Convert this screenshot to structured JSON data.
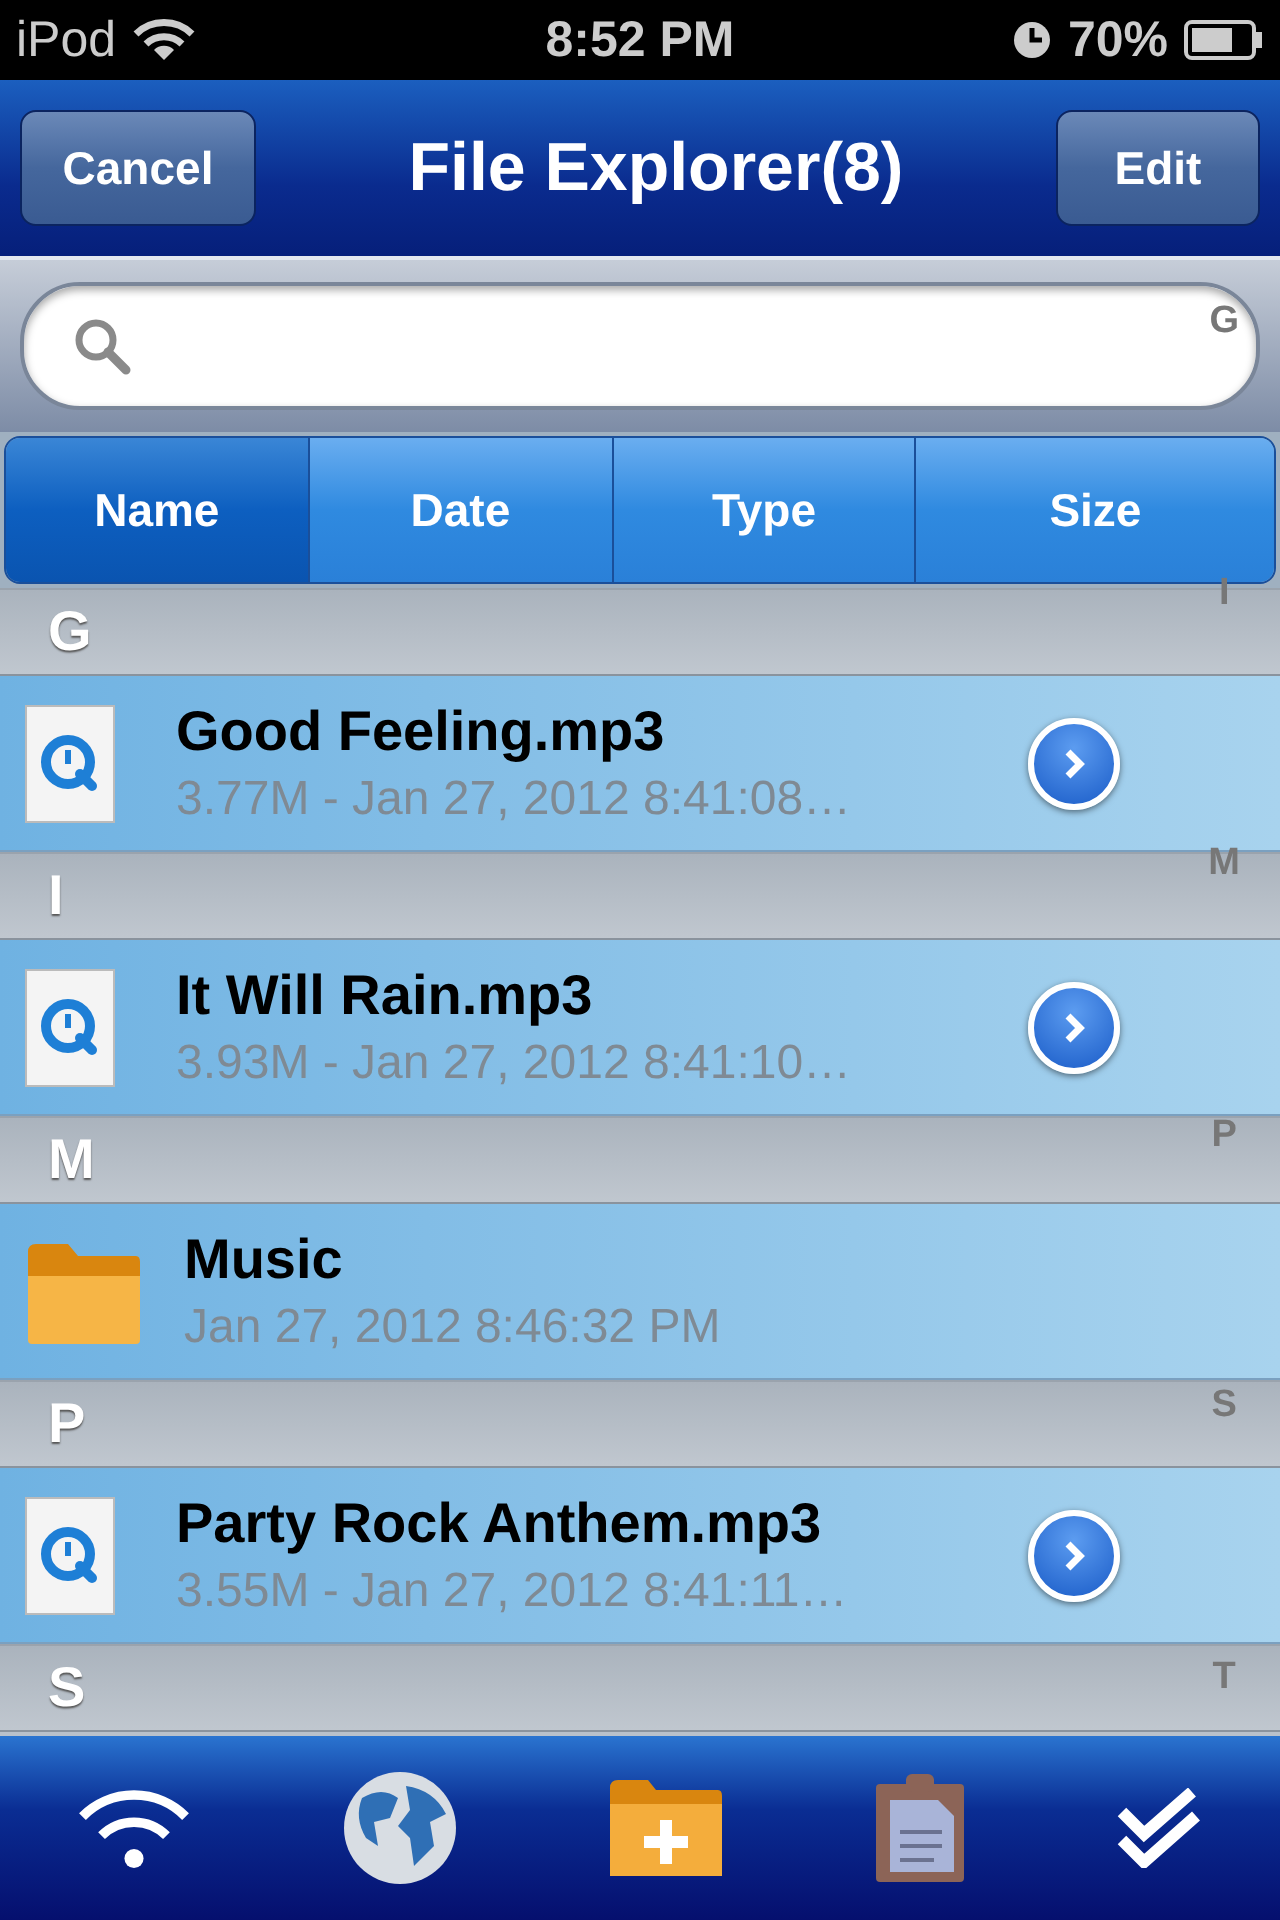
{
  "status_bar": {
    "device": "iPod",
    "time": "8:52 PM",
    "battery": "70%"
  },
  "nav": {
    "left_button": "Cancel",
    "title": "File Explorer(8)",
    "right_button": "Edit"
  },
  "sort_tabs": [
    {
      "label": "Name",
      "selected": true
    },
    {
      "label": "Date",
      "selected": false
    },
    {
      "label": "Type",
      "selected": false
    },
    {
      "label": "Size",
      "selected": false
    }
  ],
  "sections": [
    {
      "letter": "G",
      "items": [
        {
          "kind": "audio",
          "name": "Good Feeling.mp3",
          "detail": "3.77M - Jan 27, 2012 8:41:08…"
        }
      ]
    },
    {
      "letter": "I",
      "items": [
        {
          "kind": "audio",
          "name": "It Will Rain.mp3",
          "detail": "3.93M - Jan 27, 2012 8:41:10…"
        }
      ]
    },
    {
      "letter": "M",
      "items": [
        {
          "kind": "folder",
          "name": "Music",
          "detail": "Jan 27, 2012 8:46:32 PM"
        }
      ]
    },
    {
      "letter": "P",
      "items": [
        {
          "kind": "audio",
          "name": "Party Rock Anthem.mp3",
          "detail": "3.55M - Jan 27, 2012 8:41:11…"
        }
      ]
    },
    {
      "letter": "S"
    }
  ],
  "index": [
    "G",
    "I",
    "M",
    "P",
    "S",
    "T"
  ]
}
